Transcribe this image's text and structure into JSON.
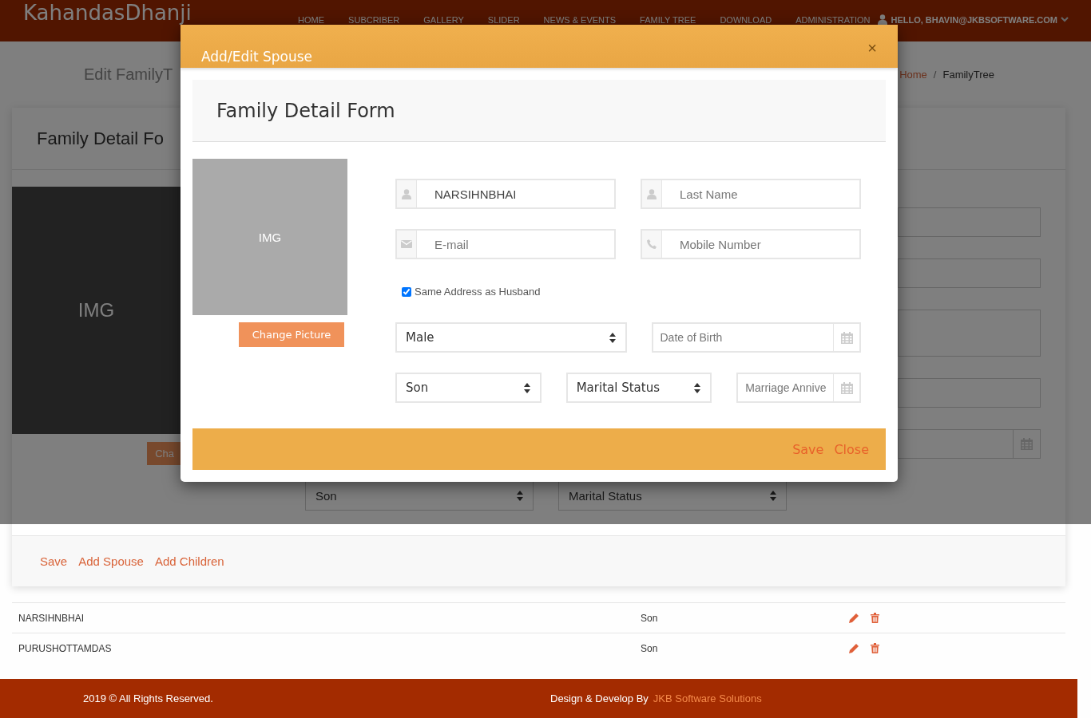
{
  "header": {
    "logo": "KahandasDhanji",
    "nav": [
      "HOME",
      "SUBCRIBER",
      "GALLERY",
      "SLIDER",
      "NEWS & EVENTS",
      "FAMILY TREE",
      "DOWNLOAD",
      "ADMINISTRATION"
    ],
    "user": "HELLO, BHAVIN@JKBSOFTWARE.COM"
  },
  "page": {
    "title": "Edit FamilyT",
    "breadcrumb": [
      "Home",
      "FamilyTree"
    ],
    "separator": "/"
  },
  "card": {
    "title": "Family Detail Fo",
    "image_label": "IMG",
    "change_button": "Cha",
    "fields": [
      {
        "kind": "text"
      },
      {
        "kind": "text"
      },
      {
        "kind": "textarea"
      },
      {
        "kind": "text"
      },
      {
        "kind": "date"
      }
    ],
    "selects": [
      "Son",
      "Marital Status"
    ],
    "actions": [
      "Save",
      "Add Spouse",
      "Add Children"
    ]
  },
  "table": {
    "rows": [
      {
        "name": "NARSIHNBHAI",
        "relation": "Son"
      },
      {
        "name": "PURUSHOTTAMDAS",
        "relation": "Son"
      }
    ]
  },
  "modal": {
    "title": "Add/Edit Spouse",
    "close": "×",
    "form_title": "Family Detail Form",
    "image_label": "IMG",
    "change_button": "Change Picture",
    "rows": [
      [
        {
          "kind": "name",
          "value": "NARSIHNBHAI"
        },
        {
          "kind": "name",
          "placeholder": "Last Name"
        }
      ],
      [
        {
          "kind": "email",
          "placeholder": "E-mail"
        },
        {
          "kind": "phone",
          "placeholder": "Mobile Number"
        }
      ],
      [
        {
          "kind": "checkbox",
          "label": "Same Address as Husband",
          "checked": true
        }
      ],
      [
        {
          "kind": "select",
          "value": "Male"
        },
        {
          "kind": "date",
          "placeholder": "Date of Birth"
        }
      ],
      [
        {
          "kind": "select",
          "value": "Son"
        },
        {
          "kind": "select",
          "value": "Marital Status"
        },
        {
          "kind": "date",
          "placeholder": "Marriage Annive"
        }
      ]
    ],
    "actions": [
      "Save",
      "Close"
    ]
  },
  "footer": {
    "copyright": "2019 © All Rights Reserved.",
    "credit": "Design & Develop By",
    "company": "JKB Software Solutions"
  }
}
